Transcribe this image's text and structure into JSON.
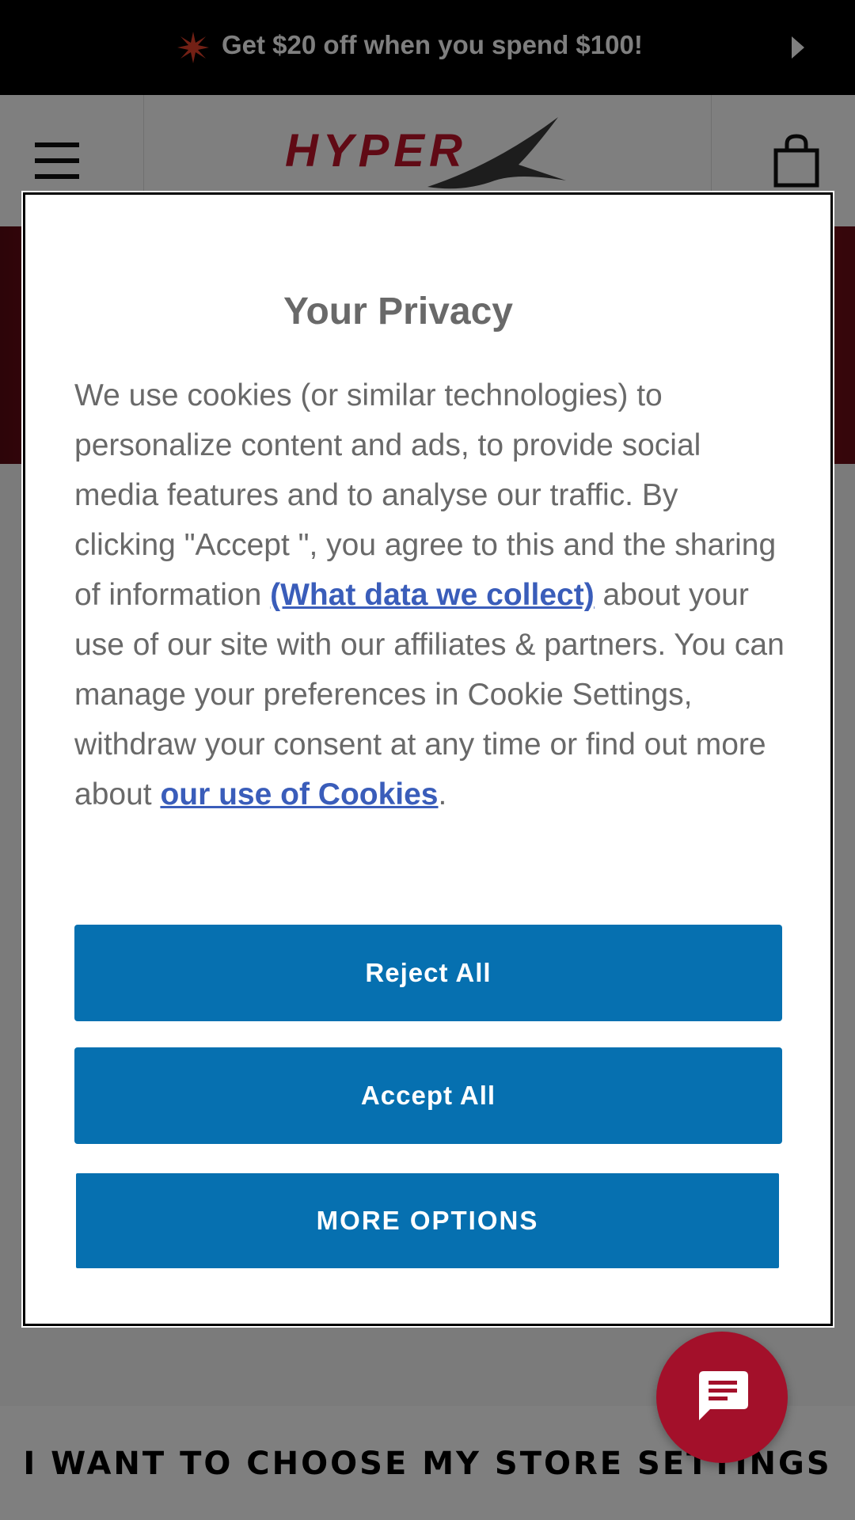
{
  "promo": {
    "text": "Get $20 off when you spend $100!"
  },
  "header": {
    "logo_text": "HYPERX"
  },
  "store": {
    "settings_text": "I WANT TO CHOOSE MY STORE SETTINGS"
  },
  "dialog": {
    "title": "Your Privacy",
    "body_part1": "We use cookies (or similar technologies) to personalize content and ads, to provide social media features and to analyse our traffic. By clicking \"Accept \", you agree to this and the sharing of information ",
    "link_data": "(What data we collect)",
    "body_part2": " about your use of our site with our affiliates & partners. You can manage your preferences in Cookie Settings, withdraw your consent at any time or find out more about ",
    "link_cookies": "our use of Cookies",
    "body_end": ".",
    "reject_label": "Reject All",
    "accept_label": "Accept All",
    "more_label": "MORE OPTIONS"
  },
  "colors": {
    "button": "#0670b0",
    "link": "#3a5dba",
    "brand_red": "#c0142a",
    "chat": "#a3102a"
  }
}
